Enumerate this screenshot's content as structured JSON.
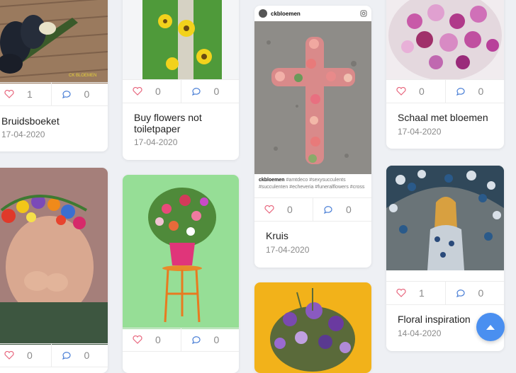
{
  "cards": [
    {
      "id": "bruidsboeket",
      "title": "Bruidsboeket",
      "date": "17-04-2020",
      "likes": "1",
      "comments": "0"
    },
    {
      "id": "buy-flowers",
      "title": "Buy flowers not toiletpaper",
      "date": "17-04-2020",
      "likes": "0",
      "comments": "0"
    },
    {
      "id": "kruis",
      "title": "Kruis",
      "date": "17-04-2020",
      "likes": "0",
      "comments": "0",
      "embed": {
        "username": "ckbloemen",
        "caption_user": "ckbloemen",
        "caption_text": "#amtdeco #sexysucculents #succulenten #echeveria #funeralflowers #cross"
      }
    },
    {
      "id": "schaal",
      "title": "Schaal met bloemen",
      "date": "17-04-2020",
      "likes": "0",
      "comments": "0"
    },
    {
      "id": "girl-crown",
      "likes": "0",
      "comments": "0"
    },
    {
      "id": "pink-pot",
      "likes": "0",
      "comments": "0"
    },
    {
      "id": "floral-inspiration",
      "title": "Floral inspiration",
      "date": "14-04-2020",
      "likes": "1",
      "comments": "0"
    }
  ],
  "colors": {
    "heart": "#e8677e",
    "comment": "#4a7fd6",
    "accent": "#4a8ff0"
  },
  "icons": {
    "like": "heart-icon",
    "comment": "comment-icon",
    "scroll": "arrow-up-icon",
    "instagram": "instagram-icon"
  }
}
